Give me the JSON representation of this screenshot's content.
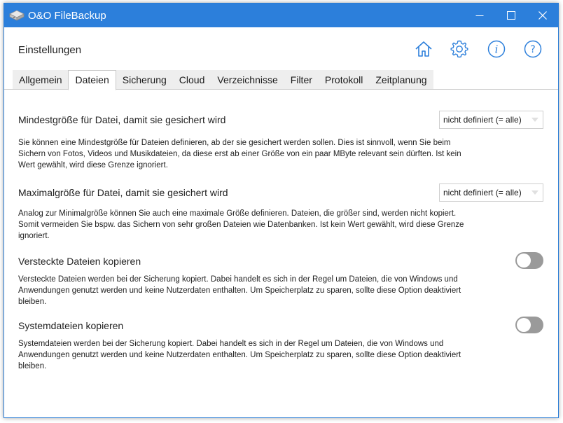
{
  "window": {
    "title": "O&O FileBackup",
    "accent": "#2c7fdb"
  },
  "header": {
    "title": "Einstellungen",
    "icons": [
      "home-icon",
      "gear-icon",
      "info-icon",
      "help-icon"
    ]
  },
  "tabs": [
    {
      "label": "Allgemein",
      "active": false
    },
    {
      "label": "Dateien",
      "active": true
    },
    {
      "label": "Sicherung",
      "active": false
    },
    {
      "label": "Cloud",
      "active": false
    },
    {
      "label": "Verzeichnisse",
      "active": false
    },
    {
      "label": "Filter",
      "active": false
    },
    {
      "label": "Protokoll",
      "active": false
    },
    {
      "label": "Zeitplanung",
      "active": false
    }
  ],
  "settings": {
    "min_size": {
      "title": "Mindestgröße für Datei, damit sie gesichert wird",
      "value": "nicht definiert (= alle)",
      "desc_lines": [
        "Sie können eine Mindestgröße für Dateien definieren, ab der sie gesichert werden sollen. Dies ist sinnvoll, wenn Sie beim",
        "Sichern von Fotos, Videos und Musikdateien, da diese erst ab einer Größe von ein paar MByte relevant sein dürften. Ist kein",
        "Wert gewählt, wird diese Grenze ignoriert."
      ]
    },
    "max_size": {
      "title": "Maximalgröße für Datei, damit sie gesichert wird",
      "value": "nicht definiert (= alle)",
      "desc_lines": [
        "Analog zur Minimalgröße können Sie auch eine maximale Größe definieren. Dateien, die größer sind, werden nicht kopiert.",
        "Somit vermeiden Sie bspw. das Sichern von sehr großen Dateien wie Datenbanken. Ist kein Wert gewählt, wird diese Grenze",
        "ignoriert."
      ]
    },
    "hidden_files": {
      "title": "Versteckte Dateien kopieren",
      "enabled": false,
      "desc_lines": [
        "Versteckte Dateien werden bei der Sicherung kopiert. Dabei handelt es sich in der Regel um Dateien, die von Windows und",
        "Anwendungen genutzt werden und keine Nutzerdaten enthalten. Um Speicherplatz zu sparen, sollte diese Option deaktiviert",
        "bleiben."
      ]
    },
    "system_files": {
      "title": "Systemdateien kopieren",
      "enabled": false,
      "desc_lines": [
        "Systemdateien werden bei der Sicherung kopiert. Dabei handelt es sich in der Regel um Dateien, die von Windows und",
        "Anwendungen genutzt werden und keine Nutzerdaten enthalten. Um Speicherplatz zu sparen, sollte diese Option deaktiviert",
        "bleiben."
      ]
    }
  }
}
